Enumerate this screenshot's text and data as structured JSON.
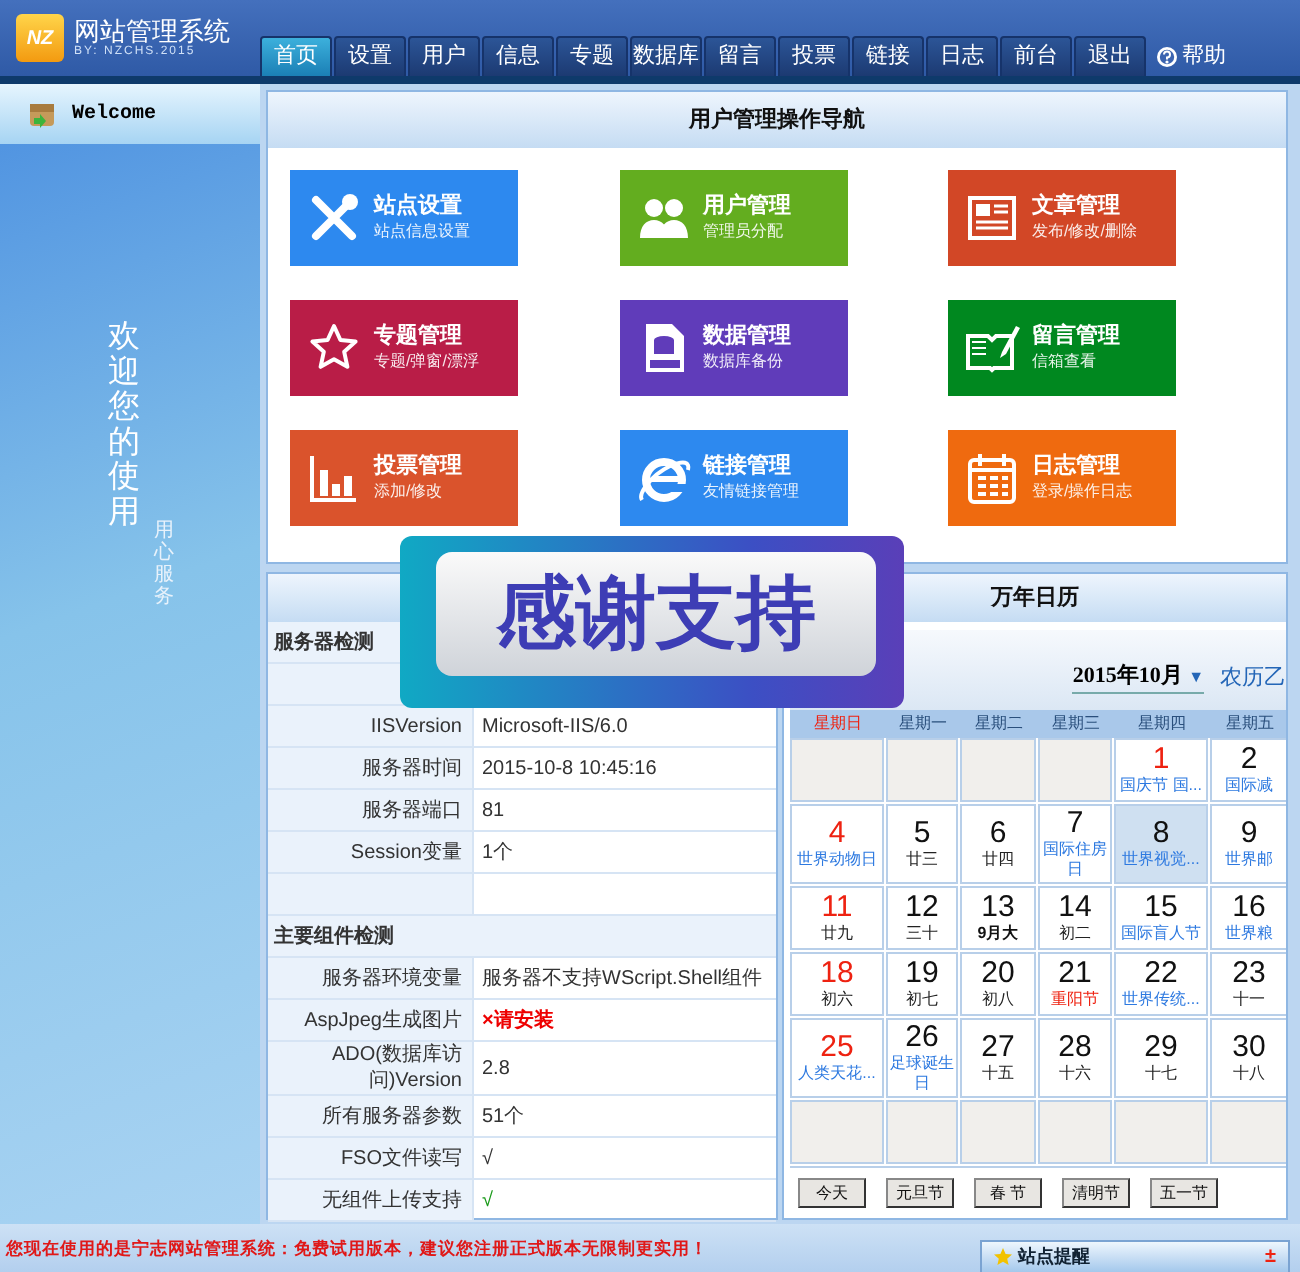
{
  "header": {
    "logo_text": "NZ",
    "title": "网站管理系统",
    "subtitle": "BY: NZCHS.2015"
  },
  "tabs": [
    {
      "label": "首页",
      "selected": true
    },
    {
      "label": "设置",
      "selected": false
    },
    {
      "label": "用户",
      "selected": false
    },
    {
      "label": "信息",
      "selected": false
    },
    {
      "label": "专题",
      "selected": false
    },
    {
      "label": "数据库",
      "selected": false
    },
    {
      "label": "留言",
      "selected": false
    },
    {
      "label": "投票",
      "selected": false
    },
    {
      "label": "链接",
      "selected": false
    },
    {
      "label": "日志",
      "selected": false
    },
    {
      "label": "前台",
      "selected": false
    },
    {
      "label": "退出",
      "selected": false
    }
  ],
  "help": {
    "label": "帮助"
  },
  "sidebar": {
    "welcome": "Welcome",
    "slogan": "欢迎您的使用",
    "motto": "用心服务"
  },
  "nav_panel": {
    "title": "用户管理操作导航",
    "tiles": [
      {
        "title": "站点设置",
        "subtitle": "站点信息设置",
        "color": "#2d89ef",
        "kind": "tools"
      },
      {
        "title": "用户管理",
        "subtitle": "管理员分配",
        "color": "#63ad1f",
        "kind": "users"
      },
      {
        "title": "文章管理",
        "subtitle": "发布/修改/删除",
        "color": "#d24726",
        "kind": "article"
      },
      {
        "title": "专题管理",
        "subtitle": "专题/弹窗/漂浮",
        "color": "#b91d47",
        "kind": "star"
      },
      {
        "title": "数据管理",
        "subtitle": "数据库备份",
        "color": "#603cba",
        "kind": "data"
      },
      {
        "title": "留言管理",
        "subtitle": "信箱查看",
        "color": "#00881f",
        "kind": "book"
      },
      {
        "title": "投票管理",
        "subtitle": "添加/修改",
        "color": "#da532c",
        "kind": "chart"
      },
      {
        "title": "链接管理",
        "subtitle": "友情链接管理",
        "color": "#2d89ef",
        "kind": "browser"
      },
      {
        "title": "日志管理",
        "subtitle": "登录/操作日志",
        "color": "#ef6a0f",
        "kind": "calendar"
      }
    ]
  },
  "server_panel": {
    "rows": [
      {
        "kind": "section",
        "label": "服务器检测"
      },
      {
        "kind": "blank"
      },
      {
        "kind": "item",
        "label": "IISVersion",
        "value": "Microsoft-IIS/6.0"
      },
      {
        "kind": "item",
        "label": "服务器时间",
        "value": "2015-10-8 10:45:16"
      },
      {
        "kind": "item",
        "label": "服务器端口",
        "value": "81"
      },
      {
        "kind": "item",
        "label": "Session变量",
        "value": "1个"
      },
      {
        "kind": "blank"
      },
      {
        "kind": "section",
        "label": "主要组件检测"
      },
      {
        "kind": "item",
        "label": "服务器环境变量",
        "value": "服务器不支持WScript.Shell组件"
      },
      {
        "kind": "warning",
        "label": "AspJpeg生成图片",
        "value": "×请安装"
      },
      {
        "kind": "item",
        "label": "ADO(数据库访问)Version",
        "value": "2.8"
      },
      {
        "kind": "item",
        "label": "所有服务器参数",
        "value": "51个"
      },
      {
        "kind": "item",
        "label": "FSO文件读写",
        "value": "√"
      },
      {
        "kind": "success",
        "label": "无组件上传支持",
        "value": "√"
      }
    ]
  },
  "calendar": {
    "title": "万年日历",
    "month": "2015年10月",
    "month_caret": "▼",
    "lunar": "农历乙",
    "weekdays": [
      {
        "label": "星期日",
        "red": true
      },
      {
        "label": "星期一",
        "red": false
      },
      {
        "label": "星期二",
        "red": false
      },
      {
        "label": "星期三",
        "red": false
      },
      {
        "label": "星期四",
        "red": false
      },
      {
        "label": "星期五",
        "red": false
      }
    ],
    "weeks": [
      [
        {
          "day": "1",
          "red": true,
          "note": "国庆节 国...",
          "kind": "festival",
          "selected": false
        },
        {
          "day": "2",
          "red": false,
          "note": "国际减",
          "kind": "festival",
          "selected": false
        }
      ],
      [
        {
          "day": "4",
          "red": true,
          "note": "世界动物日",
          "kind": "festival",
          "selected": false
        },
        {
          "day": "5",
          "red": false,
          "note": "廿三",
          "kind": "lunar",
          "selected": false
        },
        {
          "day": "6",
          "red": false,
          "note": "廿四",
          "kind": "lunar",
          "selected": false
        },
        {
          "day": "7",
          "red": false,
          "note": "国际住房日",
          "kind": "festival",
          "selected": false
        },
        {
          "day": "8",
          "red": false,
          "note": "世界视觉...",
          "kind": "festival",
          "selected": true
        },
        {
          "day": "9",
          "red": false,
          "note": "世界邮",
          "kind": "festival",
          "selected": false
        }
      ],
      [
        {
          "day": "11",
          "red": true,
          "note": "廿九",
          "kind": "lunar",
          "selected": false
        },
        {
          "day": "12",
          "red": false,
          "note": "三十",
          "kind": "lunar",
          "selected": false
        },
        {
          "day": "13",
          "red": false,
          "note": "9月大",
          "kind": "month",
          "selected": false
        },
        {
          "day": "14",
          "red": false,
          "note": "初二",
          "kind": "lunar",
          "selected": false
        },
        {
          "day": "15",
          "red": false,
          "note": "国际盲人节",
          "kind": "festival",
          "selected": false
        },
        {
          "day": "16",
          "red": false,
          "note": "世界粮",
          "kind": "festival",
          "selected": false
        }
      ],
      [
        {
          "day": "18",
          "red": true,
          "note": "初六",
          "kind": "lunar",
          "selected": false
        },
        {
          "day": "19",
          "red": false,
          "note": "初七",
          "kind": "lunar",
          "selected": false
        },
        {
          "day": "20",
          "red": false,
          "note": "初八",
          "kind": "lunar",
          "selected": false
        },
        {
          "day": "21",
          "red": false,
          "note": "重阳节",
          "kind": "holiday",
          "selected": false
        },
        {
          "day": "22",
          "red": false,
          "note": "世界传统...",
          "kind": "festival",
          "selected": false
        },
        {
          "day": "23",
          "red": false,
          "note": "十一",
          "kind": "lunar",
          "selected": false
        }
      ],
      [
        {
          "day": "25",
          "red": true,
          "note": "人类天花...",
          "kind": "festival",
          "selected": false
        },
        {
          "day": "26",
          "red": false,
          "note": "足球诞生日",
          "kind": "festival",
          "selected": false
        },
        {
          "day": "27",
          "red": false,
          "note": "十五",
          "kind": "lunar",
          "selected": false
        },
        {
          "day": "28",
          "red": false,
          "note": "十六",
          "kind": "lunar",
          "selected": false
        },
        {
          "day": "29",
          "red": false,
          "note": "十七",
          "kind": "lunar",
          "selected": false
        },
        {
          "day": "30",
          "red": false,
          "note": "十八",
          "kind": "lunar",
          "selected": false
        }
      ]
    ],
    "buttons": [
      "今天",
      "元旦节",
      "春 节",
      "清明节",
      "五一节"
    ]
  },
  "popup": {
    "text": "感谢支持"
  },
  "footer": {
    "notice": "您现在使用的是宁志网站管理系统：免费试用版本，建议您注册正式版本无限制更实用！",
    "reminder": {
      "title": "站点提醒",
      "toggle": "±"
    }
  }
}
